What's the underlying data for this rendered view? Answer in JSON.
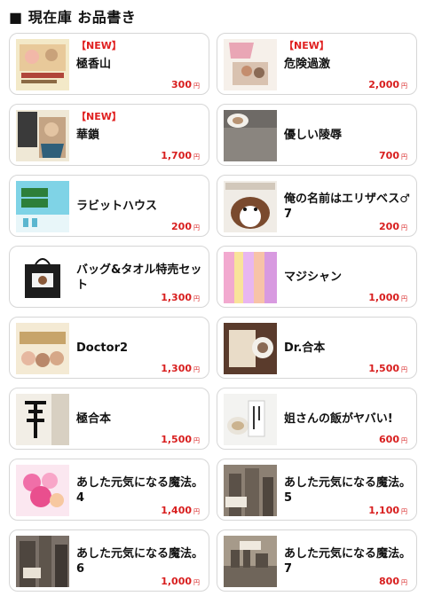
{
  "header": {
    "title": "■ 現在庫 お品書き"
  },
  "products": [
    {
      "new": "【NEW】",
      "title": "極香山",
      "price": "300",
      "yen": "円",
      "icon": "book-cover-icon"
    },
    {
      "new": "【NEW】",
      "title": "危険過激",
      "price": "2,000",
      "yen": "円",
      "icon": "book-cover-icon"
    },
    {
      "new": "【NEW】",
      "title": "華鎖",
      "price": "1,700",
      "yen": "円",
      "icon": "book-cover-icon"
    },
    {
      "new": "",
      "title": "優しい陵辱",
      "price": "700",
      "yen": "円",
      "icon": "book-cover-icon"
    },
    {
      "new": "",
      "title": "ラビットハウス",
      "price": "200",
      "yen": "円",
      "icon": "book-cover-icon"
    },
    {
      "new": "",
      "title": "俺の名前はエリザベス♂7",
      "price": "200",
      "yen": "円",
      "icon": "book-cover-icon"
    },
    {
      "new": "",
      "title": "バッグ&タオル特売セット",
      "price": "1,300",
      "yen": "円",
      "icon": "tote-bag-icon"
    },
    {
      "new": "",
      "title": "マジシャン",
      "price": "1,000",
      "yen": "円",
      "icon": "book-cover-icon"
    },
    {
      "new": "",
      "title": "Doctor2",
      "price": "1,300",
      "yen": "円",
      "icon": "book-cover-icon"
    },
    {
      "new": "",
      "title": "Dr.合本",
      "price": "1,500",
      "yen": "円",
      "icon": "book-cover-icon"
    },
    {
      "new": "",
      "title": "極合本",
      "price": "1,500",
      "yen": "円",
      "icon": "book-cover-icon"
    },
    {
      "new": "",
      "title": "姐さんの飯がヤバい!",
      "price": "600",
      "yen": "円",
      "icon": "book-cover-icon"
    },
    {
      "new": "",
      "title": "あした元気になる魔法。4",
      "price": "1,400",
      "yen": "円",
      "icon": "book-cover-icon"
    },
    {
      "new": "",
      "title": "あした元気になる魔法。5",
      "price": "1,100",
      "yen": "円",
      "icon": "book-cover-icon"
    },
    {
      "new": "",
      "title": "あした元気になる魔法。6",
      "price": "1,000",
      "yen": "円",
      "icon": "book-cover-icon"
    },
    {
      "new": "",
      "title": "あした元気になる魔法。7",
      "price": "800",
      "yen": "円",
      "icon": "book-cover-icon"
    }
  ]
}
